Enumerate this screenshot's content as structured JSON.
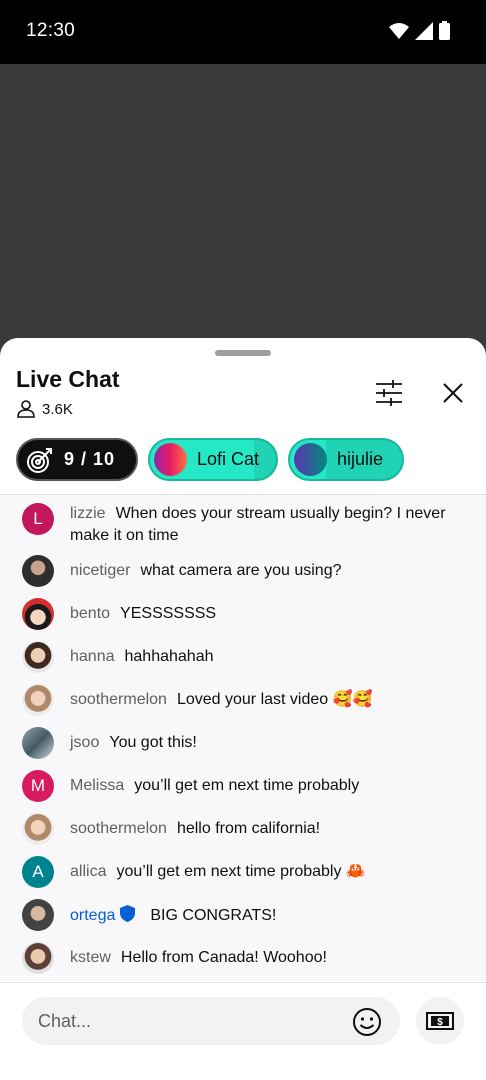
{
  "status_bar": {
    "time": "12:30"
  },
  "header": {
    "title": "Live Chat",
    "viewer_count": "3.6K"
  },
  "chips": {
    "goal": {
      "text": "9 / 10"
    },
    "users": [
      {
        "label": "Lofi Cat"
      },
      {
        "label": "hijulie"
      }
    ]
  },
  "messages": [
    {
      "author": "lizzie",
      "initial": "L",
      "avatar_color": "#c2185b",
      "text": "When does your stream usually begin? I never make it on time"
    },
    {
      "author": "nicetiger",
      "avatar_color": "#3b3b3b",
      "text": "what camera are you using?"
    },
    {
      "author": "bento",
      "avatar_color": "#d32f2f",
      "text": "YESSSSSSS"
    },
    {
      "author": "hanna",
      "avatar_color": "#8d6e63",
      "text": "hahhahahah"
    },
    {
      "author": "soothermelon",
      "avatar_color": "#a1887f",
      "text": "Loved your last video 🥰🥰"
    },
    {
      "author": "jsoo",
      "avatar_color": "#607d8b",
      "text": "You got this!"
    },
    {
      "author": "Melissa",
      "initial": "M",
      "avatar_color": "#d81b60",
      "text": "you’ll get em next time probably"
    },
    {
      "author": "soothermelon",
      "avatar_color": "#a1887f",
      "text": "hello from california!"
    },
    {
      "author": "allica",
      "initial": "A",
      "avatar_color": "#00838f",
      "text": "you’ll get em next time probably 🦀"
    },
    {
      "author": "ortega",
      "avatar_color": "#616161",
      "text": "BIG CONGRATS!",
      "owner": true
    },
    {
      "author": "kstew",
      "avatar_color": "#795548",
      "text": "Hello from Canada! Woohoo!"
    }
  ],
  "input": {
    "placeholder": "Chat..."
  },
  "colors": {
    "chip_accent": "#25e8c6",
    "owner_name": "#065fd4"
  }
}
